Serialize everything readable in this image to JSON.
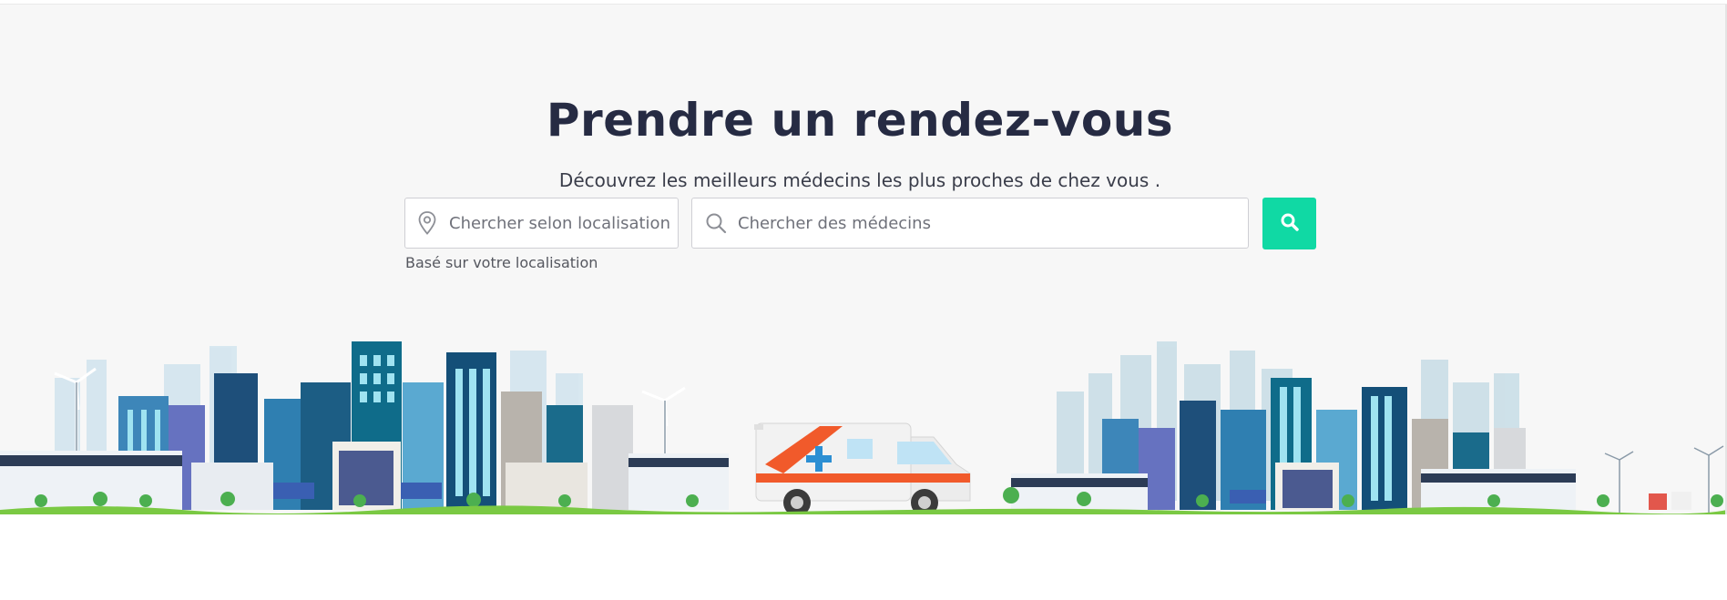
{
  "hero": {
    "title": "Prendre un rendez-vous",
    "subtitle": "Découvrez les meilleurs médecins les plus proches de chez vous ."
  },
  "search": {
    "location_placeholder": "Chercher selon localisation",
    "doctor_placeholder": "Chercher des médecins",
    "location_hint": "Basé sur votre localisation",
    "location_icon": "map-pin-icon",
    "doctor_icon": "magnifier-icon",
    "button_icon": "search-icon"
  },
  "colors": {
    "accent": "#10d9a4",
    "title": "#262b43",
    "hero_background": "#f7f7f7"
  }
}
